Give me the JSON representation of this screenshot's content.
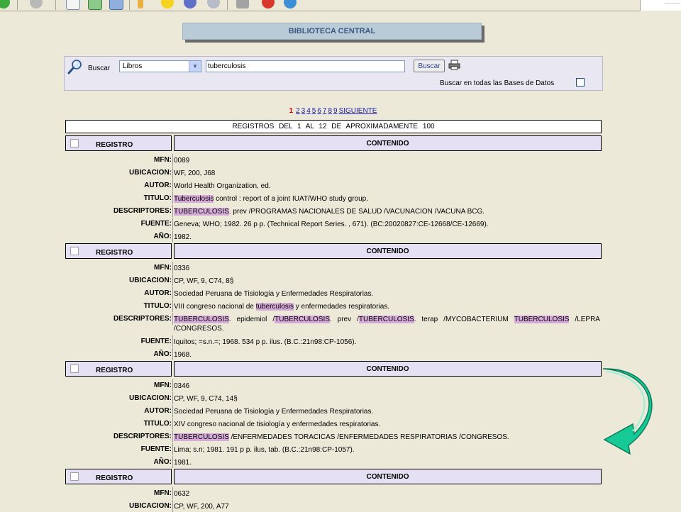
{
  "header": {
    "title": "BIBLIOTECA CENTRAL"
  },
  "search": {
    "label": "Buscar",
    "database": "Libros",
    "query": "tuberculosis",
    "button": "Buscar",
    "all_databases_label": "Buscar en todas las Bases de Datos",
    "all_databases_checked": false
  },
  "pagination": {
    "current": "1",
    "pages": [
      "2",
      "3",
      "4",
      "5",
      "6",
      "7",
      "8",
      "9"
    ],
    "next": "SIGUIENTE"
  },
  "summary": "REGISTROS DEL 1 AL 12 DE APROXIMADAMENTE 100",
  "labels": {
    "registro": "REGISTRO",
    "contenido": "CONTENIDO",
    "mfn": "MFN:",
    "ubicacion": "UBICACION:",
    "autor": "AUTOR:",
    "titulo": "TITULO:",
    "descriptores": "DESCRIPTORES:",
    "fuente": "FUENTE:",
    "ano": "AÑO:"
  },
  "records": [
    {
      "mfn": "0089",
      "ubicacion": "WF, 200, J68",
      "autor": "World Health Organization, ed.",
      "titulo": [
        {
          "t": "Tuberculosis",
          "hl": true
        },
        {
          "t": " control : report of a joint IUAT/WHO study group."
        }
      ],
      "descriptores": [
        {
          "t": "TUBERCULOSIS",
          "hl": true
        },
        {
          "t": ". prev /PROGRAMAS NACIONALES DE SALUD /VACUNACION /VACUNA BCG."
        }
      ],
      "fuente": "Geneva; WHO; 1982. 26 p p. (Technical Report Series. , 671). (BC:20020827:CE-12668/CE-12669).",
      "ano": "1982."
    },
    {
      "mfn": "0336",
      "ubicacion": "CP, WF, 9, C74, 8§",
      "autor": "Sociedad Peruana de Tisiología y Enfermedades Respiratorias.",
      "titulo": [
        {
          "t": "VIII congreso nacional de "
        },
        {
          "t": "tuberculosis",
          "hl": true
        },
        {
          "t": " y enfermedades respiratorias."
        }
      ],
      "descriptores": [
        {
          "t": "TUBERCULOSIS",
          "hl": true
        },
        {
          "t": ". epidemiol /"
        },
        {
          "t": "TUBERCULOSIS",
          "hl": true
        },
        {
          "t": ". prev /"
        },
        {
          "t": "TUBERCULOSIS",
          "hl": true
        },
        {
          "t": ". terap /MYCOBACTERIUM "
        },
        {
          "t": "TUBERCULOSIS",
          "hl": true
        },
        {
          "t": " /LEPRA /CONGRESOS."
        }
      ],
      "fuente": "Iquitos; =s.n.=; 1968. 534 p p. ilus. (B.C.:21n98:CP-1056).",
      "ano": "1968."
    },
    {
      "mfn": "0346",
      "ubicacion": "CP, WF, 9, C74, 14§",
      "autor": "Sociedad Peruana de Tisiología y Enfermedades Respiratorias.",
      "titulo": [
        {
          "t": "XIV congreso nacional de tisiología y enfermedades respiratorias."
        }
      ],
      "descriptores": [
        {
          "t": "TUBERCULOSIS",
          "hl": true
        },
        {
          "t": " /ENFERMEDADES TORACICAS /ENFERMEDADES RESPIRATORIAS /CONGRESOS."
        }
      ],
      "fuente": "Lima; s.n; 1981. 191 p p. ilus, tab. (B.C.:21n98:CP-1057).",
      "ano": "1981."
    },
    {
      "mfn": "0632",
      "ubicacion": "CP, WF, 200, A77"
    }
  ],
  "colors": {
    "highlight": "#d6abd9",
    "record_header_bg": "#e6e0f4",
    "title_text": "#3b5a82",
    "page_current": "#d40000",
    "link": "#1a1ab5",
    "arrow_fill": "#17c994"
  }
}
